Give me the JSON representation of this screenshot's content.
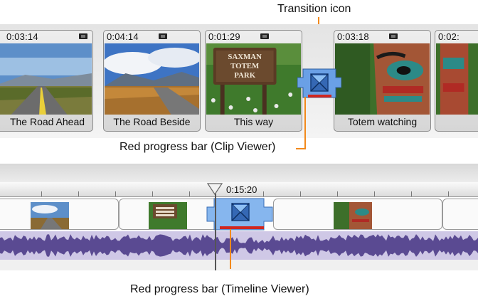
{
  "annotations": {
    "transition_icon": "Transition icon",
    "progress_clip_viewer": "Red progress bar (Clip Viewer)",
    "progress_timeline_viewer": "Red progress bar (Timeline Viewer)"
  },
  "clip_viewer": {
    "clips": [
      {
        "time": "0:03:14",
        "label": "The Road Ahead"
      },
      {
        "time": "0:04:14",
        "label": "The Road Beside"
      },
      {
        "time": "0:01:29",
        "label": "This way"
      },
      {
        "time": "0:03:18",
        "label": "Totem watching"
      },
      {
        "time": "0:02:",
        "label": ""
      }
    ],
    "sign_text": [
      "SAXMAN",
      "TOTEM",
      "PARK"
    ]
  },
  "timeline_viewer": {
    "playhead_time": "0:15:20"
  },
  "colors": {
    "accent_orange": "#f28a1c",
    "transition_blue": "#6aa0e6",
    "progress_red": "#d0261e",
    "audio_waveform": "#5a4a92"
  }
}
